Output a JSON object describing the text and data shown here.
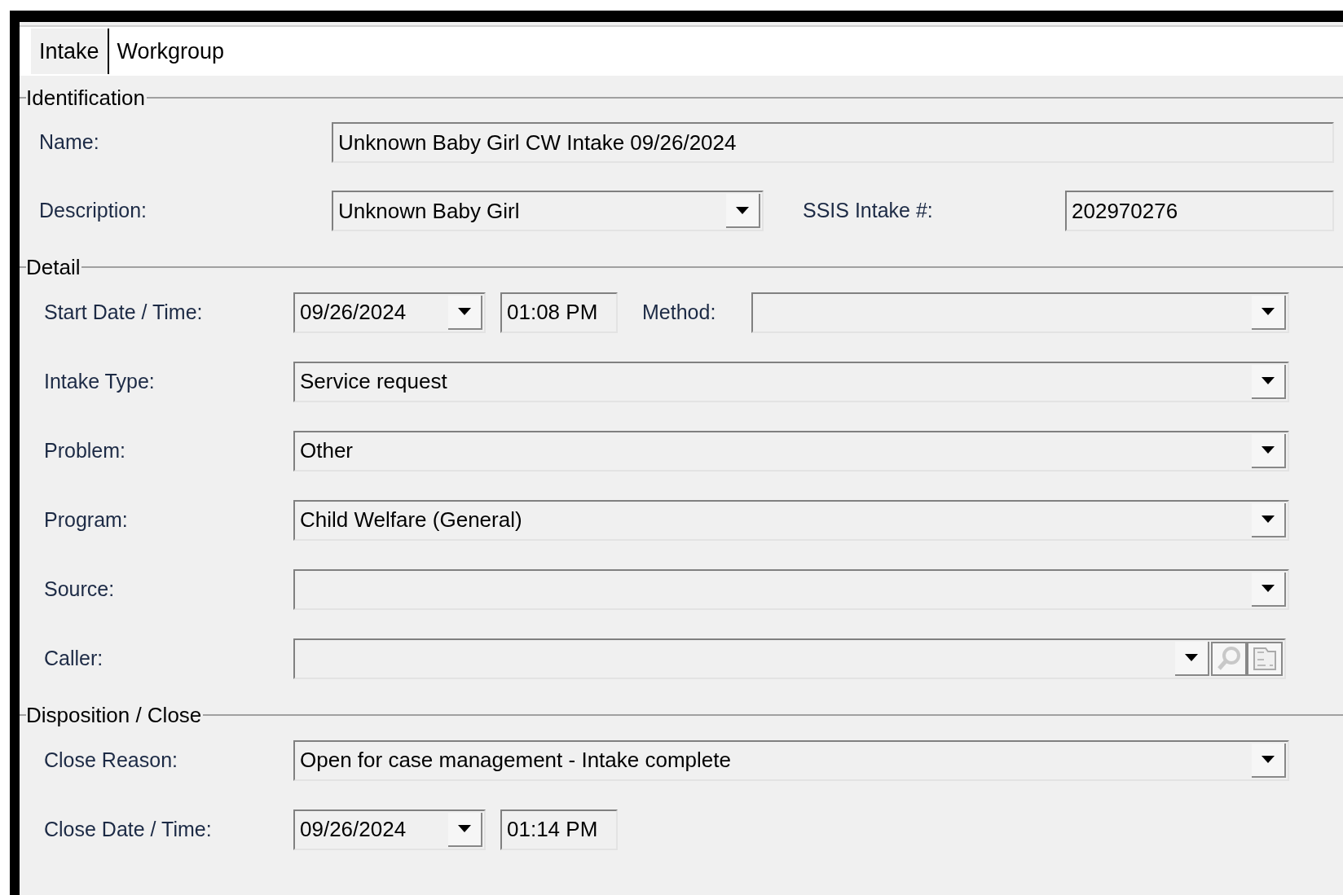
{
  "tabs": [
    {
      "label": "Intake",
      "selected": true
    },
    {
      "label": "Workgroup",
      "selected": false
    }
  ],
  "sections": [
    {
      "title": "Identification",
      "rows": [
        {
          "kind": "text",
          "label": "Name:",
          "value": "Unknown Baby Girl CW Intake 09/26/2024"
        },
        {
          "kind": "combo_field",
          "label": "Description:",
          "value": "Unknown Baby Girl",
          "field_label": "SSIS Intake #:",
          "field_value": "202970276"
        }
      ]
    },
    {
      "title": "Detail",
      "rows": [
        {
          "kind": "datetime",
          "label": "Start Date / Time:",
          "date": "09/26/2024",
          "time": "01:08 PM",
          "extra_label": "Method:"
        },
        {
          "kind": "combo",
          "label": "Intake Type:",
          "value": "Service request"
        },
        {
          "kind": "combo",
          "label": "Problem:",
          "value": "Other"
        },
        {
          "kind": "combo",
          "label": "Program:",
          "value": "Child Welfare (General)"
        },
        {
          "kind": "combo",
          "label": "Source:"
        },
        {
          "kind": "lookup",
          "label": "Caller:"
        }
      ]
    },
    {
      "title": "Disposition / Close",
      "rows": [
        {
          "kind": "combo",
          "label": "Close Reason:",
          "value": "Open for case management - Intake complete"
        },
        {
          "kind": "datetime",
          "label": "Close Date / Time:",
          "date": "09/26/2024",
          "time": "01:14 PM"
        }
      ]
    }
  ]
}
